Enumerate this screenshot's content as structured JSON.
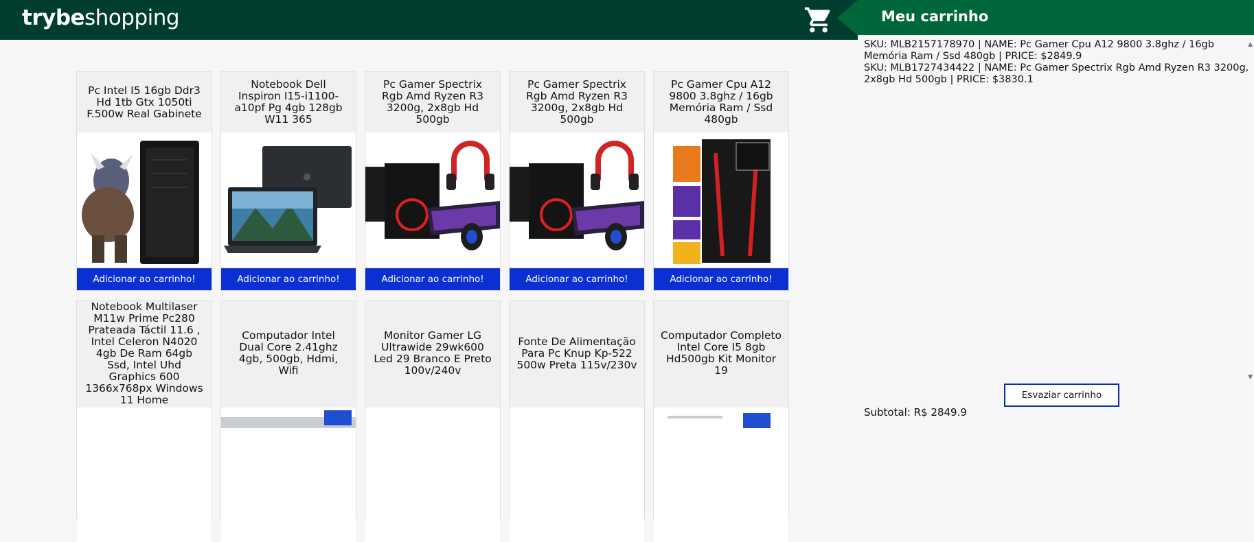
{
  "header": {
    "logo_bold": "trybe",
    "logo_light": "shopping"
  },
  "cart": {
    "title": "Meu carrinho",
    "items": [
      "SKU: MLB2157178970 | NAME: Pc Gamer Cpu A12 9800 3.8ghz / 16gb Memória Ram / Ssd 480gb | PRICE: $2849.9",
      "SKU: MLB1727434422 | NAME: Pc Gamer Spectrix Rgb Amd Ryzen R3 3200g, 2x8gb Hd 500gb | PRICE: $3830.1"
    ],
    "empty_button": "Esvaziar carrinho",
    "subtotal": "Subtotal: R$ 2849.9"
  },
  "products": {
    "add_label": "Adicionar ao carrinho!",
    "row1": [
      {
        "title": "Pc Intel I5 16gb Ddr3 Hd 1tb Gtx 1050ti F.500w Real Gabinete",
        "image": "pc-tower-warrior"
      },
      {
        "title": "Notebook Dell Inspiron I15-i1100-a10pf Pg 4gb 128gb W11 365",
        "image": "laptop"
      },
      {
        "title": "Pc Gamer Spectrix Rgb Amd Ryzen R3 3200g, 2x8gb Hd 500gb",
        "image": "gamer-kit"
      },
      {
        "title": "Pc Gamer Spectrix Rgb Amd Ryzen R3 3200g, 2x8gb Hd 500gb",
        "image": "gamer-kit"
      },
      {
        "title": "Pc Gamer Cpu A12 9800 3.8ghz / 16gb Memória Ram / Ssd 480gb",
        "image": "amd-tower"
      }
    ],
    "row2": [
      {
        "title": "Notebook Multilaser M11w Prime Pc280 Prateada Táctil 11.6 , Intel Celeron N4020 4gb De Ram 64gb Ssd, Intel Uhd Graphics 600 1366x768px Windows 11 Home"
      },
      {
        "title": "Computador Intel Dual Core 2.41ghz 4gb, 500gb, Hdmi, Wifi"
      },
      {
        "title": "Monitor Gamer LG Ultrawide 29wk600 Led 29 Branco E Preto 100v/240v"
      },
      {
        "title": "Fonte De Alimentação Para Pc Knup Kp-522 500w Preta 115v/230v"
      },
      {
        "title": "Computador Completo Intel Core I5 8gb Hd500gb Kit Monitor 19"
      }
    ]
  }
}
